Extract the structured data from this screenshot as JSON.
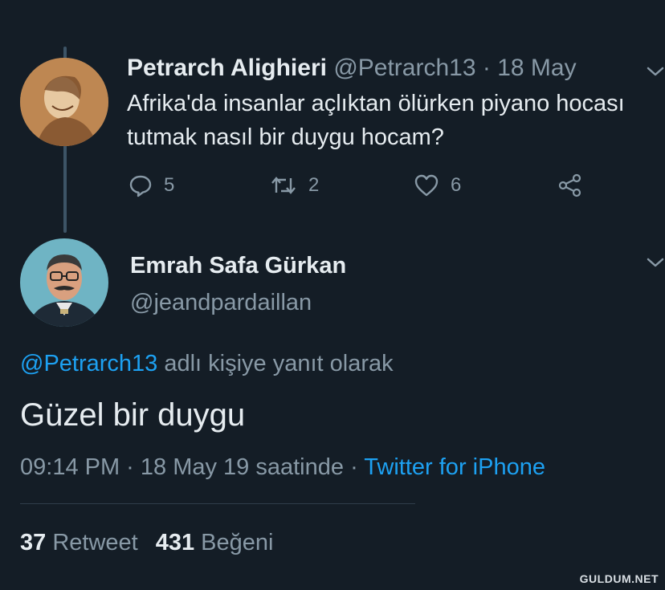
{
  "tweet1": {
    "author_name": "Petrarch Alighieri",
    "handle": "@Petrarch13",
    "separator": "·",
    "date": "18 May",
    "text": "Afrika'da insanlar açlıktan ölürken piyano hocası tutmak nasıl bir duygu hocam?",
    "reply_count": "5",
    "retweet_count": "2",
    "like_count": "6"
  },
  "tweet2": {
    "author_name": "Emrah Safa Gürkan",
    "handle": "@jeandpardaillan",
    "reply_to_handle": "@Petrarch13",
    "reply_to_suffix": "adlı kişiye yanıt olarak",
    "text": "Güzel bir duygu",
    "timestamp": "09:14 PM · 18 May 19 saatinde",
    "source_separator": "·",
    "source": "Twitter for iPhone",
    "retweets_count": "37",
    "retweets_label": "Retweet",
    "likes_count": "431",
    "likes_label": "Beğeni"
  },
  "watermark": "GULDUM.NET",
  "colors": {
    "background": "#141d26",
    "primary_text": "#e6ecf0",
    "secondary_text": "#8899a6",
    "link": "#1da1f2",
    "thread_line": "#3d5466"
  },
  "icons": [
    "reply-icon",
    "retweet-icon",
    "like-icon",
    "share-icon",
    "chevron-down-icon"
  ]
}
